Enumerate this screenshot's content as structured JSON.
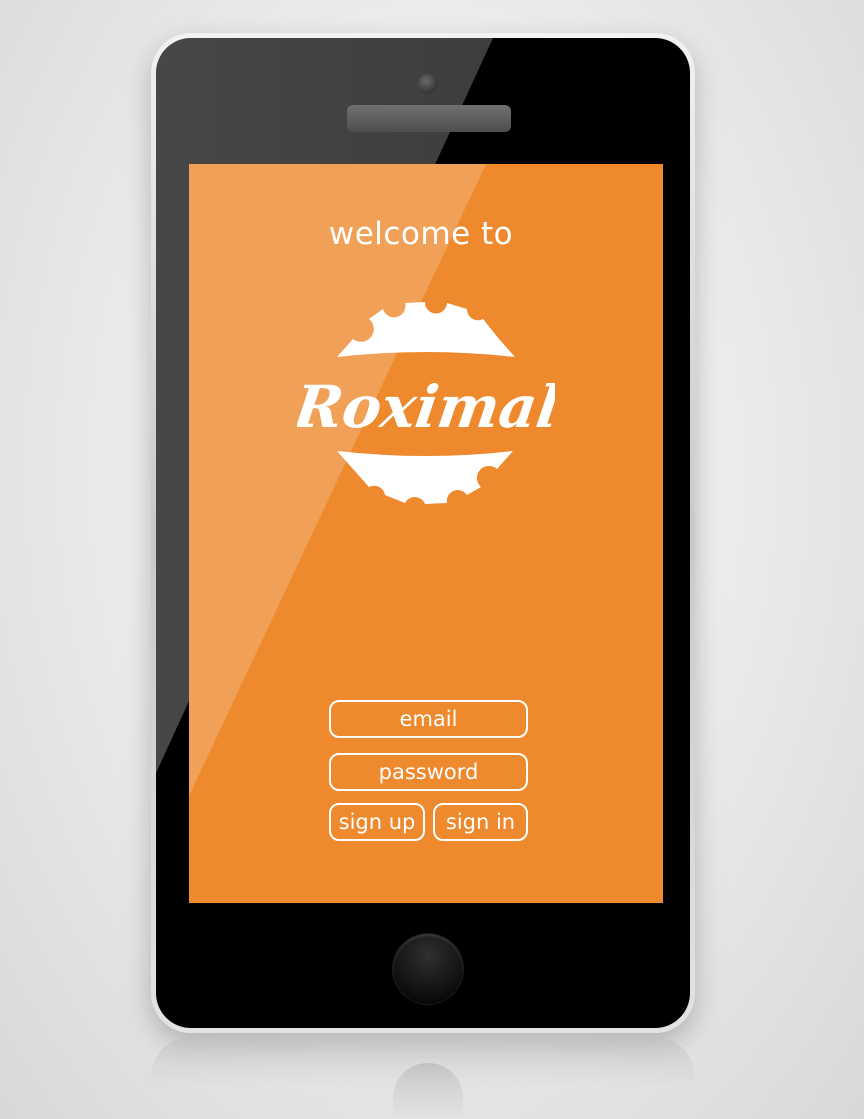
{
  "screen": {
    "welcome_text": "welcome to",
    "logo_text": "Roximal",
    "email_placeholder": "email",
    "password_placeholder": "password",
    "signup_label": "sign up",
    "signin_label": "sign in"
  },
  "colors": {
    "screen_background": "#ee892d",
    "foreground": "#ffffff",
    "device_bezel": "#000000"
  },
  "icons": {
    "logo": "gear-badge-icon",
    "home": "home-button-icon",
    "camera": "front-camera-icon",
    "speaker": "earpiece-speaker-icon"
  }
}
